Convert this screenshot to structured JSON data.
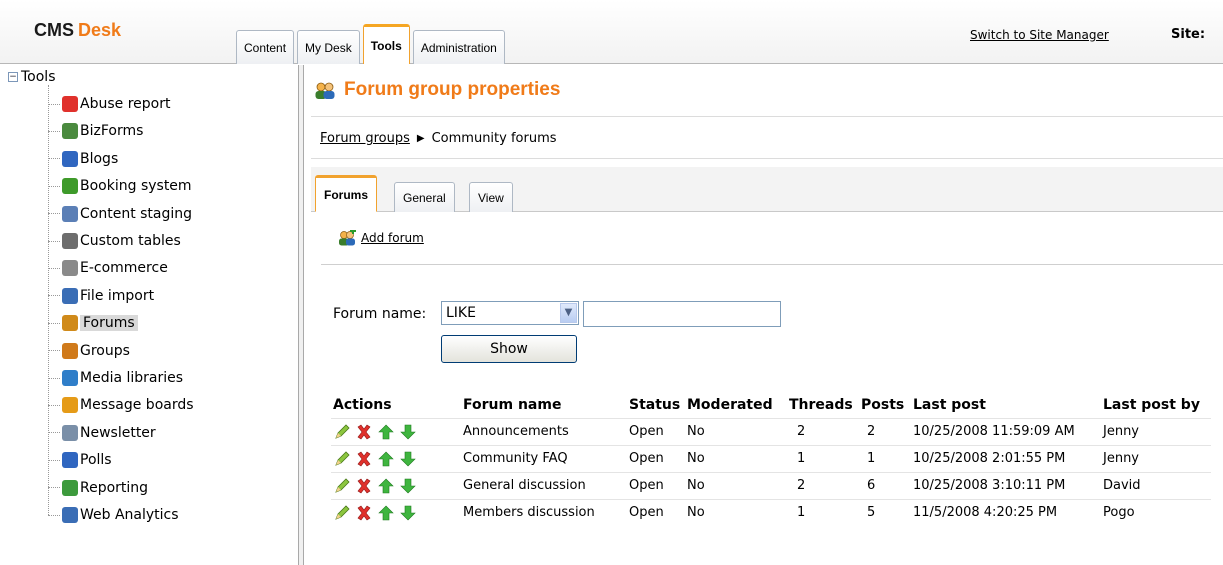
{
  "header": {
    "logo_main": "CMS",
    "logo_sub": "Desk",
    "tabs": [
      {
        "label": "Content"
      },
      {
        "label": "My Desk"
      },
      {
        "label": "Tools"
      },
      {
        "label": "Administration"
      }
    ],
    "switch_link": "Switch to Site Manager",
    "site_label": "Site:"
  },
  "tree": {
    "root": "Tools",
    "toggle": "−",
    "items": [
      {
        "label": "Abuse report",
        "icon": "abuse-report-icon"
      },
      {
        "label": "BizForms",
        "icon": "bizforms-icon"
      },
      {
        "label": "Blogs",
        "icon": "blogs-icon"
      },
      {
        "label": "Booking system",
        "icon": "booking-system-icon"
      },
      {
        "label": "Content staging",
        "icon": "content-staging-icon"
      },
      {
        "label": "Custom tables",
        "icon": "custom-tables-icon"
      },
      {
        "label": "E-commerce",
        "icon": "ecommerce-icon"
      },
      {
        "label": "File import",
        "icon": "file-import-icon"
      },
      {
        "label": "Forums",
        "icon": "forums-icon",
        "selected": true
      },
      {
        "label": "Groups",
        "icon": "groups-icon"
      },
      {
        "label": "Media libraries",
        "icon": "media-libraries-icon"
      },
      {
        "label": "Message boards",
        "icon": "message-boards-icon"
      },
      {
        "label": "Newsletter",
        "icon": "newsletter-icon"
      },
      {
        "label": "Polls",
        "icon": "polls-icon"
      },
      {
        "label": "Reporting",
        "icon": "reporting-icon"
      },
      {
        "label": "Web Analytics",
        "icon": "web-analytics-icon"
      }
    ]
  },
  "main": {
    "title": "Forum group properties",
    "breadcrumb": {
      "link": "Forum groups",
      "separator": "▶",
      "current": "Community forums"
    },
    "tabs": [
      {
        "label": "Forums"
      },
      {
        "label": "General"
      },
      {
        "label": "View"
      }
    ],
    "add_forum": "Add forum",
    "filter": {
      "label": "Forum name:",
      "operator": "LIKE",
      "value": "",
      "show_button": "Show"
    },
    "table": {
      "columns": [
        "Actions",
        "Forum name",
        "Status",
        "Moderated",
        "Threads",
        "Posts",
        "Last post",
        "Last post by"
      ],
      "rows": [
        {
          "name": "Announcements",
          "status": "Open",
          "moderated": "No",
          "threads": "2",
          "posts": "2",
          "last_post": "10/25/2008 11:59:09 AM",
          "last_post_by": "Jenny"
        },
        {
          "name": "Community FAQ",
          "status": "Open",
          "moderated": "No",
          "threads": "1",
          "posts": "1",
          "last_post": "10/25/2008 2:01:55 PM",
          "last_post_by": "Jenny"
        },
        {
          "name": "General discussion",
          "status": "Open",
          "moderated": "No",
          "threads": "2",
          "posts": "6",
          "last_post": "10/25/2008 3:10:11 PM",
          "last_post_by": "David"
        },
        {
          "name": "Members discussion",
          "status": "Open",
          "moderated": "No",
          "threads": "1",
          "posts": "5",
          "last_post": "11/5/2008 4:20:25 PM",
          "last_post_by": "Pogo"
        }
      ]
    }
  },
  "colors": {
    "accent": "#f07b19",
    "tab_active": "#f5a623"
  }
}
